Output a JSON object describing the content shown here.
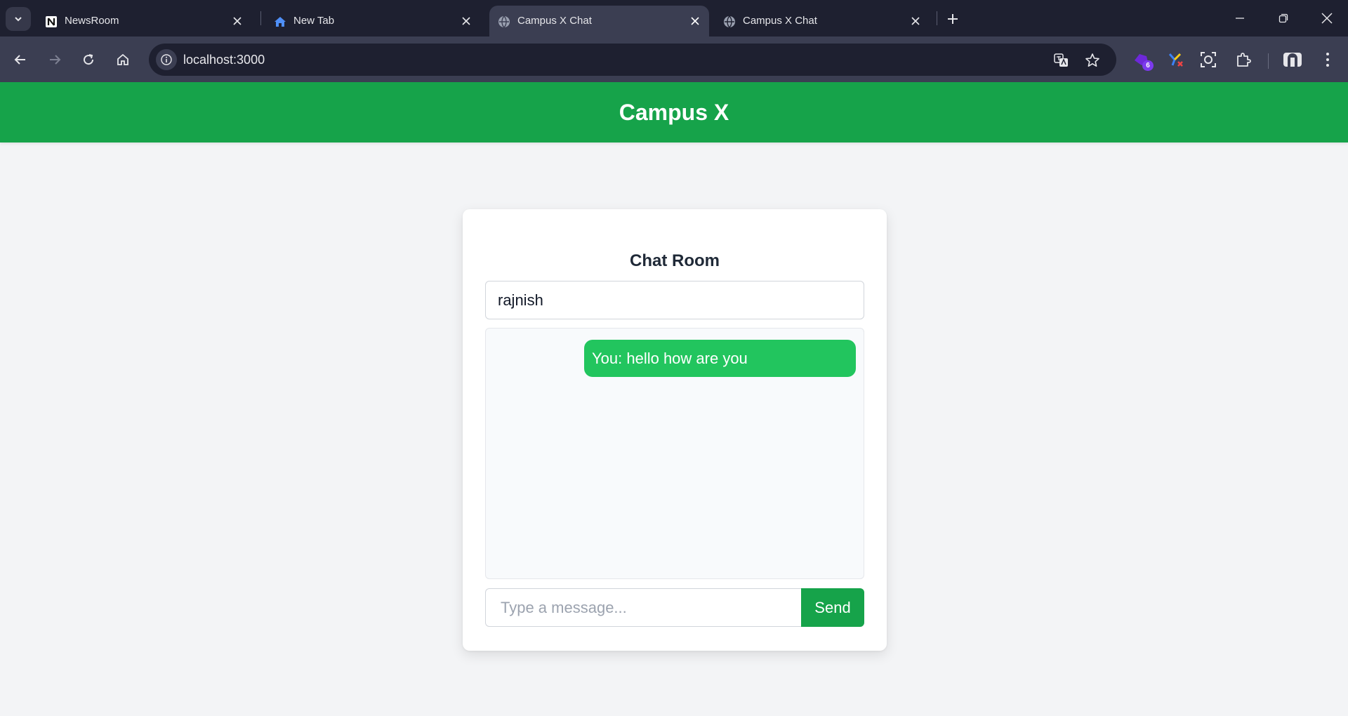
{
  "browser": {
    "tabs": [
      {
        "title": "NewsRoom",
        "favicon": "notion-icon",
        "active": false
      },
      {
        "title": "New Tab",
        "favicon": "home-icon",
        "active": false
      },
      {
        "title": "Campus X Chat",
        "favicon": "globe-icon",
        "active": true
      },
      {
        "title": "Campus X Chat",
        "favicon": "globe-icon",
        "active": false
      }
    ],
    "url": "localhost:3000",
    "extension_badge": "6"
  },
  "app": {
    "header_title": "Campus X",
    "brand_color": "#16a34a"
  },
  "chat": {
    "title": "Chat Room",
    "username_value": "rajnish",
    "messages": [
      {
        "text": "You: hello how are you",
        "own": true
      }
    ],
    "message_placeholder": "Type a message...",
    "send_label": "Send",
    "bubble_color": "#22c55e"
  }
}
